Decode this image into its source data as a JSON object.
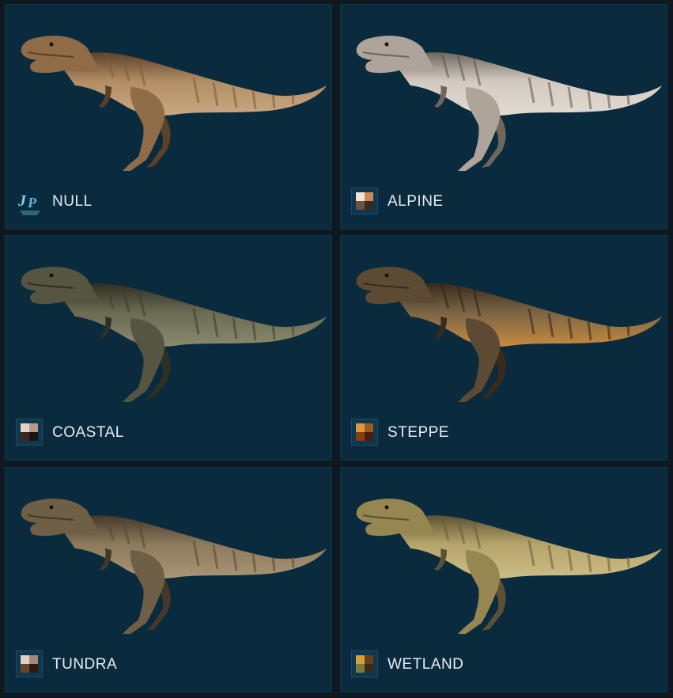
{
  "variants": [
    {
      "label": "NULL",
      "icon": "jp-logo-icon",
      "skin": {
        "base": "#b28d64",
        "mid": "#8f6b48",
        "dark": "#5a4128",
        "belly": "#c9a982",
        "stripe": "#7a5a3a"
      }
    },
    {
      "label": "ALPINE",
      "swatch": [
        "#f2e3d3",
        "#c9875a",
        "#6e5142",
        "#3a2a22"
      ],
      "skin": {
        "base": "#d2cac0",
        "mid": "#aea49a",
        "dark": "#6f665e",
        "belly": "#e2dbd2",
        "stripe": "#5d554e"
      }
    },
    {
      "label": "COASTAL",
      "swatch": [
        "#e4d3c8",
        "#b89a8c",
        "#3b271e",
        "#1c1412"
      ],
      "skin": {
        "base": "#6b6a52",
        "mid": "#555541",
        "dark": "#2f2f24",
        "belly": "#8a8a6c",
        "stripe": "#3f3a2b"
      }
    },
    {
      "label": "STEPPE",
      "swatch": [
        "#d99a3b",
        "#9c5a1e",
        "#8b3d14",
        "#4a1e0c"
      ],
      "skin": {
        "base": "#7a6446",
        "mid": "#5c4a33",
        "dark": "#3a2a1c",
        "belly": "#c88a3e",
        "stripe": "#2e2216"
      }
    },
    {
      "label": "TUNDRA",
      "swatch": [
        "#e0d0c6",
        "#a58a78",
        "#6a452b",
        "#2e1c12"
      ],
      "skin": {
        "base": "#8d7a5c",
        "mid": "#6f5f46",
        "dark": "#43382a",
        "belly": "#a99574",
        "stripe": "#564632"
      }
    },
    {
      "label": "WETLAND",
      "swatch": [
        "#d8a036",
        "#6a3f18",
        "#7b7a3a",
        "#3c2a16"
      ],
      "skin": {
        "base": "#b5a46a",
        "mid": "#968651",
        "dark": "#5c5233",
        "belly": "#cdbd86",
        "stripe": "#6a5a34"
      }
    }
  ]
}
